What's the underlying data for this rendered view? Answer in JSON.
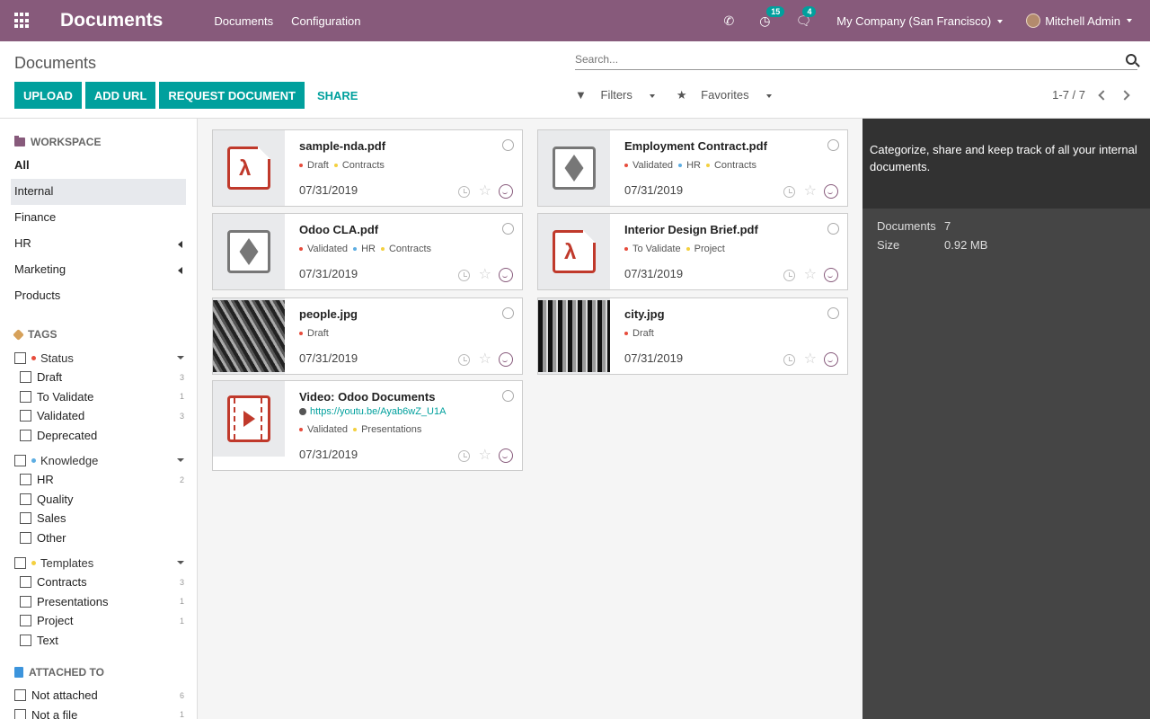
{
  "navbar": {
    "app_title": "Documents",
    "menu": [
      "Documents",
      "Configuration"
    ],
    "activity_count": "15",
    "message_count": "4",
    "company": "My Company (San Francisco)",
    "user": "Mitchell Admin",
    "color": "#875a7b"
  },
  "control_panel": {
    "breadcrumb": "Documents",
    "search_placeholder": "Search...",
    "buttons": {
      "upload": "UPLOAD",
      "add_url": "ADD URL",
      "request": "REQUEST DOCUMENT",
      "share": "SHARE"
    },
    "filters_label": "Filters",
    "favorites_label": "Favorites",
    "pager": "1-7 / 7",
    "accent": "#00a09d"
  },
  "sidebar": {
    "workspace_title": "WORKSPACE",
    "workspaces": [
      "All",
      "Internal",
      "Finance",
      "HR",
      "Marketing",
      "Products"
    ],
    "tags_title": "TAGS",
    "tag_groups": [
      {
        "name": "Status",
        "color": "#e74c3c",
        "options": [
          {
            "label": "Draft",
            "count": "3"
          },
          {
            "label": "To Validate",
            "count": "1"
          },
          {
            "label": "Validated",
            "count": "3"
          },
          {
            "label": "Deprecated",
            "count": ""
          }
        ]
      },
      {
        "name": "Knowledge",
        "color": "#5dade2",
        "options": [
          {
            "label": "HR",
            "count": "2"
          },
          {
            "label": "Quality",
            "count": ""
          },
          {
            "label": "Sales",
            "count": ""
          },
          {
            "label": "Other",
            "count": ""
          }
        ]
      },
      {
        "name": "Templates",
        "color": "#f4d03f",
        "options": [
          {
            "label": "Contracts",
            "count": "3"
          },
          {
            "label": "Presentations",
            "count": "1"
          },
          {
            "label": "Project",
            "count": "1"
          },
          {
            "label": "Text",
            "count": ""
          }
        ]
      }
    ],
    "attached_title": "ATTACHED TO",
    "attached": [
      {
        "label": "Not attached",
        "count": "6"
      },
      {
        "label": "Not a file",
        "count": "1"
      }
    ]
  },
  "documents": [
    {
      "name": "sample-nda.pdf",
      "tags": [
        "Draft",
        "Contracts"
      ],
      "date": "07/31/2019",
      "kind": "pdf"
    },
    {
      "name": "Employment Contract.pdf",
      "tags": [
        "Validated",
        "HR",
        "Contracts"
      ],
      "date": "07/31/2019",
      "kind": "box"
    },
    {
      "name": "Odoo CLA.pdf",
      "tags": [
        "Validated",
        "HR",
        "Contracts"
      ],
      "date": "07/31/2019",
      "kind": "box"
    },
    {
      "name": "Interior Design Brief.pdf",
      "tags": [
        "To Validate",
        "Project"
      ],
      "date": "07/31/2019",
      "kind": "pdf"
    },
    {
      "name": "people.jpg",
      "tags": [
        "Draft"
      ],
      "date": "07/31/2019",
      "kind": "photo"
    },
    {
      "name": "city.jpg",
      "tags": [
        "Draft"
      ],
      "date": "07/31/2019",
      "kind": "photo2"
    },
    {
      "name": "Video: Odoo Documents",
      "url": "https://youtu.be/Ayab6wZ_U1A",
      "tags": [
        "Validated",
        "Presentations"
      ],
      "date": "07/31/2019",
      "kind": "video"
    }
  ],
  "right_panel": {
    "help": "Categorize, share and keep track of all your internal documents.",
    "documents_label": "Documents",
    "documents_value": "7",
    "size_label": "Size",
    "size_value": "0.92 MB"
  }
}
